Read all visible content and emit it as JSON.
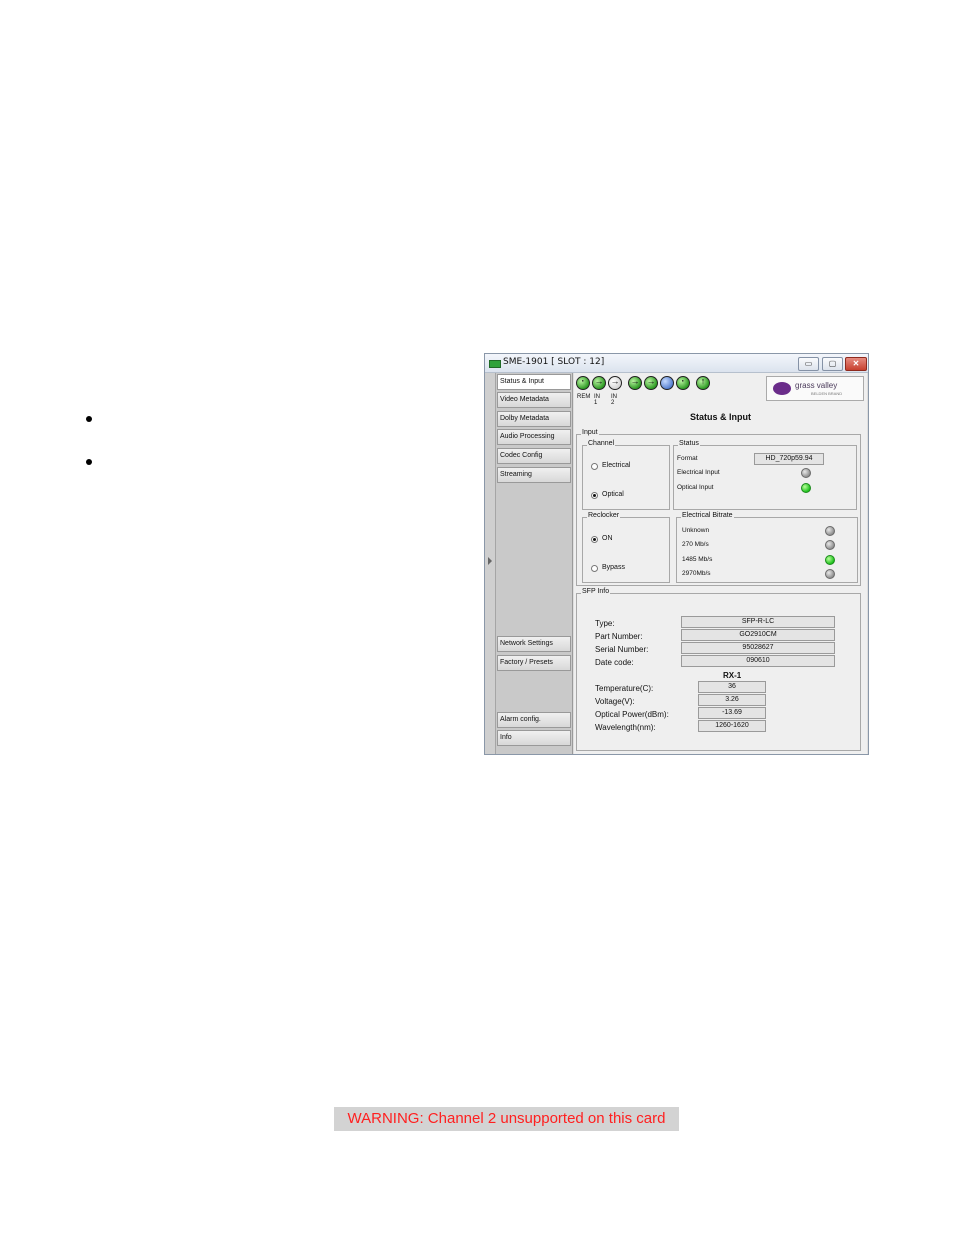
{
  "window": {
    "title": "SME-1901 [ SLOT : 12]",
    "buttons": [
      "▭",
      "▢",
      "✕"
    ]
  },
  "sidebar": {
    "items": [
      {
        "label": "Status & Input",
        "active": true
      },
      {
        "label": "Video Metadata"
      },
      {
        "label": "Dolby Metadata"
      },
      {
        "label": "Audio Processing"
      },
      {
        "label": "Codec Config"
      },
      {
        "label": "Streaming"
      },
      {
        "label": "Network Settings"
      },
      {
        "label": "Factory / Presets"
      },
      {
        "label": "Alarm config."
      },
      {
        "label": "Info"
      }
    ]
  },
  "toolbar": {
    "labels": [
      "REM",
      "IN 1",
      "IN 2"
    ]
  },
  "logo": {
    "text": "grass valley",
    "sub": "BELDEN BRAND"
  },
  "page_title": "Status & Input",
  "input": {
    "legend": "Input",
    "channel": {
      "legend": "Channel",
      "options": [
        "Electrical",
        "Optical"
      ],
      "selected": "Optical"
    },
    "status": {
      "legend": "Status",
      "format_label": "Format",
      "format_value": "HD_720p59.94",
      "electrical_input_label": "Electrical Input",
      "electrical_input_state": "off",
      "optical_input_label": "Optical Input",
      "optical_input_state": "on"
    },
    "reclocker": {
      "legend": "Reclocker",
      "options": [
        "ON",
        "Bypass"
      ],
      "selected": "ON"
    },
    "bitrate": {
      "legend": "Electrical Bitrate",
      "rows": [
        {
          "label": "Unknown",
          "state": "off"
        },
        {
          "label": "270 Mb/s",
          "state": "off"
        },
        {
          "label": "1485 Mb/s",
          "state": "on"
        },
        {
          "label": "2970Mb/s",
          "state": "off"
        }
      ]
    }
  },
  "sfp": {
    "legend": "SFP Info",
    "type_label": "Type:",
    "type_value": "SFP-R-LC",
    "part_label": "Part Number:",
    "part_value": "GO2910CM",
    "serial_label": "Serial Number:",
    "serial_value": "95028627",
    "date_label": "Date code:",
    "date_value": "090610",
    "rx_label": "RX-1",
    "temp_label": "Temperature(C):",
    "temp_value": "36",
    "voltage_label": "Voltage(V):",
    "voltage_value": "3.26",
    "power_label": "Optical Power(dBm):",
    "power_value": "-13.69",
    "wave_label": "Wavelength(nm):",
    "wave_value": "1260-1620"
  },
  "warning": "WARNING: Channel 2 unsupported on this card",
  "colors": {
    "led_on": "#1fc21f",
    "warning_text": "#ff2020",
    "warning_bg": "#d3d3d3",
    "logo": "#6a2c8a"
  }
}
